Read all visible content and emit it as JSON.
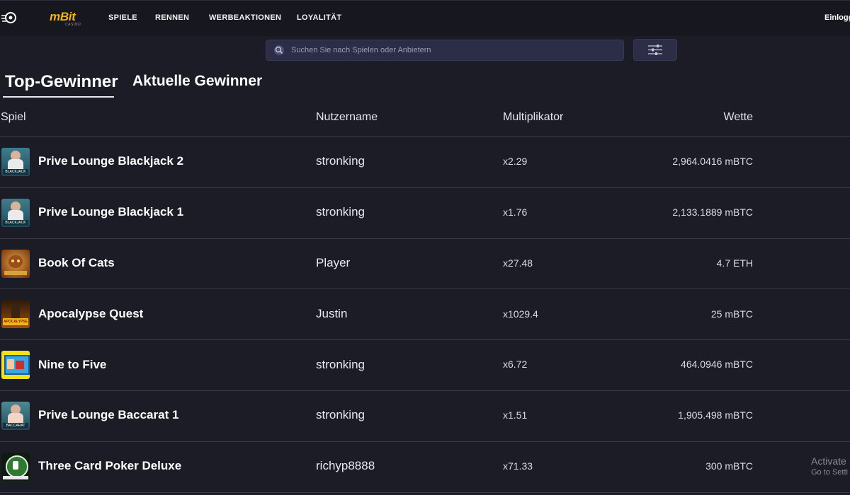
{
  "header": {
    "logo_text": "mBit",
    "logo_sub": "CASINO",
    "nav": [
      "SPIELE",
      "RENNEN",
      "WERBEAKTIONEN",
      "LOYALITÄT"
    ],
    "login_label": "Einlogg"
  },
  "search": {
    "placeholder": "Suchen Sie nach Spielen oder Anbietern"
  },
  "tabs": [
    {
      "label": "Top-Gewinner",
      "active": true
    },
    {
      "label": "Aktuelle Gewinner",
      "active": false
    }
  ],
  "table": {
    "columns": [
      "Spiel",
      "Nutzername",
      "Multiplikator",
      "Wette"
    ],
    "rows": [
      {
        "game": "Prive Lounge Blackjack 2",
        "user": "stronking",
        "multiplier": "x2.29",
        "bet": "2,964.0416 mBTC",
        "thumb": "blackjack"
      },
      {
        "game": "Prive Lounge Blackjack 1",
        "user": "stronking",
        "multiplier": "x1.76",
        "bet": "2,133.1889 mBTC",
        "thumb": "blackjack"
      },
      {
        "game": "Book Of Cats",
        "user": "Player",
        "multiplier": "x27.48",
        "bet": "4.7 ETH",
        "thumb": "cats"
      },
      {
        "game": "Apocalypse Quest",
        "user": "Justin",
        "multiplier": "x1029.4",
        "bet": "25 mBTC",
        "thumb": "apocalypse"
      },
      {
        "game": "Nine to Five",
        "user": "stronking",
        "multiplier": "x6.72",
        "bet": "464.0946 mBTC",
        "thumb": "ninetofive"
      },
      {
        "game": "Prive Lounge Baccarat 1",
        "user": "stronking",
        "multiplier": "x1.51",
        "bet": "1,905.498 mBTC",
        "thumb": "baccarat"
      },
      {
        "game": "Three Card Poker Deluxe",
        "user": "richyp8888",
        "multiplier": "x71.33",
        "bet": "300 mBTC",
        "thumb": "poker"
      }
    ]
  },
  "watermark": {
    "line1": "Activate",
    "line2": "Go to Setti"
  },
  "colors": {
    "background": "#1b1c26",
    "topbar": "#16171f",
    "accent": "#f2b418",
    "search_bg": "#2c2e48"
  }
}
